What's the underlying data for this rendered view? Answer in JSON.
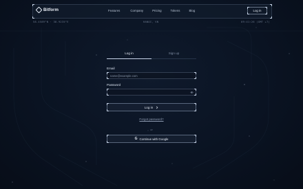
{
  "brand": {
    "name": "Bitform",
    "logo_icon": "diamond-logo-icon"
  },
  "nav": {
    "links": [
      "Features",
      "Company",
      "Pricing",
      "Tokens",
      "Blog"
    ],
    "login_label": "Log in"
  },
  "status": {
    "coordinates": "58.4589°N · 38.9235°E",
    "location": "HANOI, VN",
    "clock": "09:41:26 (GMT +7)"
  },
  "auth": {
    "tabs": {
      "login": "Log in",
      "signup": "Sign up"
    },
    "active_tab": "login",
    "email": {
      "label": "Email",
      "placeholder": "name@example.com",
      "value": ""
    },
    "password": {
      "label": "Password",
      "placeholder": "",
      "value": "",
      "toggle_icon": "eye-icon"
    },
    "submit_label": "Log in",
    "submit_icon": "chevron-right-icon",
    "forgot_label": "Forgot password?",
    "divider_label": "or",
    "google_label": "Continue with Google",
    "google_icon": "google-icon"
  },
  "colors": {
    "background": "#0a1322",
    "text": "#c9d3e2",
    "accent_border": "#aabedc"
  }
}
